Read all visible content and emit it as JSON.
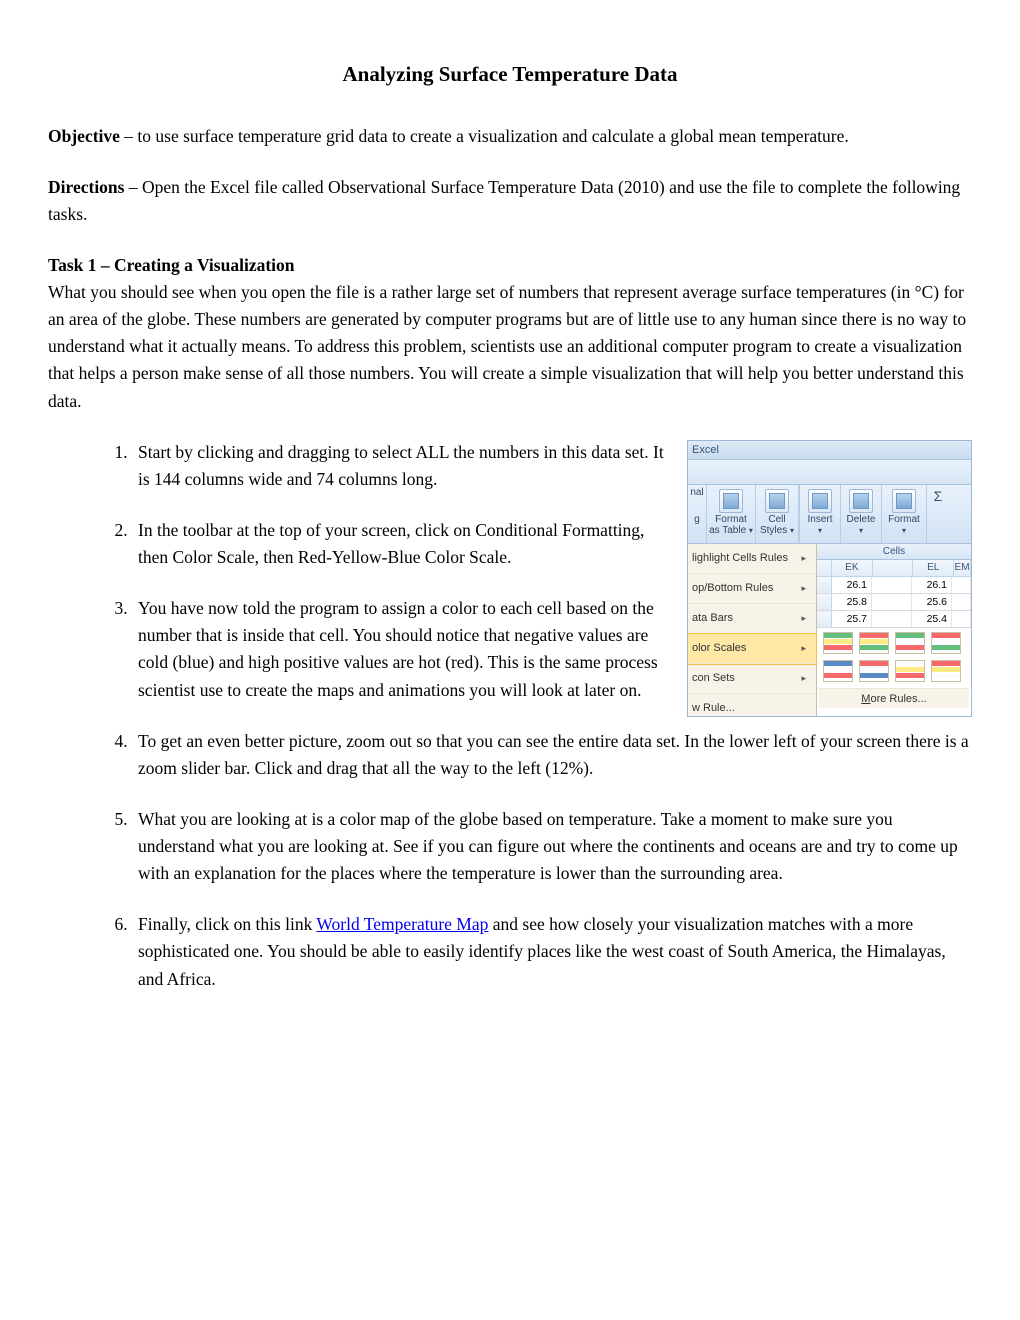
{
  "title": "Analyzing Surface Temperature Data",
  "objective": {
    "label": "Objective",
    "text": " – to use surface temperature grid data to create a visualization and calculate a global mean temperature."
  },
  "directions": {
    "label": "Directions",
    "text": " – Open the Excel file called Observational Surface Temperature Data (2010) and use the file to complete the following tasks."
  },
  "task1": {
    "heading": "Task 1 – Creating a Visualization",
    "intro": "What you should see when you open the file is a rather large set of numbers that represent average surface temperatures (in °C) for an area of the globe.  These numbers are generated by computer programs but are of little use to any human since there is no way to understand what it actually means.  To address this problem, scientists use an additional computer program to create a visualization that helps a person make sense of all those numbers.  You will create a simple visualization that will help you better understand this data."
  },
  "steps": {
    "s1": "Start by clicking and dragging to select ALL the numbers in this data set.  It is 144 columns wide and 74 columns long.",
    "s2": "In the toolbar at the top of your screen, click on Conditional Formatting, then Color Scale, then Red-Yellow-Blue Color Scale.",
    "s3": "You have now told the program to assign a color to each cell based on the number that is inside that cell.  You should notice that negative values are cold (blue) and high positive values are hot (red).  This is the same process scientist use to create the maps and animations you will look at later on.",
    "s4": "To get an even better picture, zoom out so that you can see the entire data set.  In the lower left of your screen there is a zoom slider bar.  Click and drag that all the way to the left (12%).",
    "s5": "What you are looking at is a color map of the globe based on temperature.  Take a moment to make sure you understand what you are looking at.  See if you can figure out where the continents and oceans are and try to come up with an explanation for the places where the temperature is lower than the surrounding area.",
    "s6a": "Finally, click on this link ",
    "s6_link": "World Temperature Map",
    "s6b": " and see how closely your visualization matches with a more sophisticated one.  You should be able to easily identify places like the west coast of South America, the Himalayas, and Africa."
  },
  "excel": {
    "title": "Excel",
    "ribbon": {
      "nal": "nal",
      "g": "g",
      "format": "Format",
      "as_table": "as Table",
      "cell": "Cell",
      "styles": "Styles",
      "insert": "Insert",
      "delete": "Delete",
      "format2": "Format",
      "sigma": "Σ",
      "cells_group": "Cells"
    },
    "menu": {
      "highlight": "lighlight Cells Rules",
      "topbottom": "op/Bottom Rules",
      "databars": "ata Bars",
      "colorscales": "olor Scales",
      "iconsets": "con Sets",
      "newrule": "w Rule..."
    },
    "more_m": "M",
    "more_rest": "ore Rules...",
    "sheet": {
      "col_ek": "EK",
      "col_el": "EL",
      "col_em": "EM",
      "r1c1": "26.1",
      "r1c2": "26.1",
      "r2c1": "25.8",
      "r2c2": "25.6",
      "r3c1": "25.7",
      "r3c2": "25.4"
    }
  }
}
